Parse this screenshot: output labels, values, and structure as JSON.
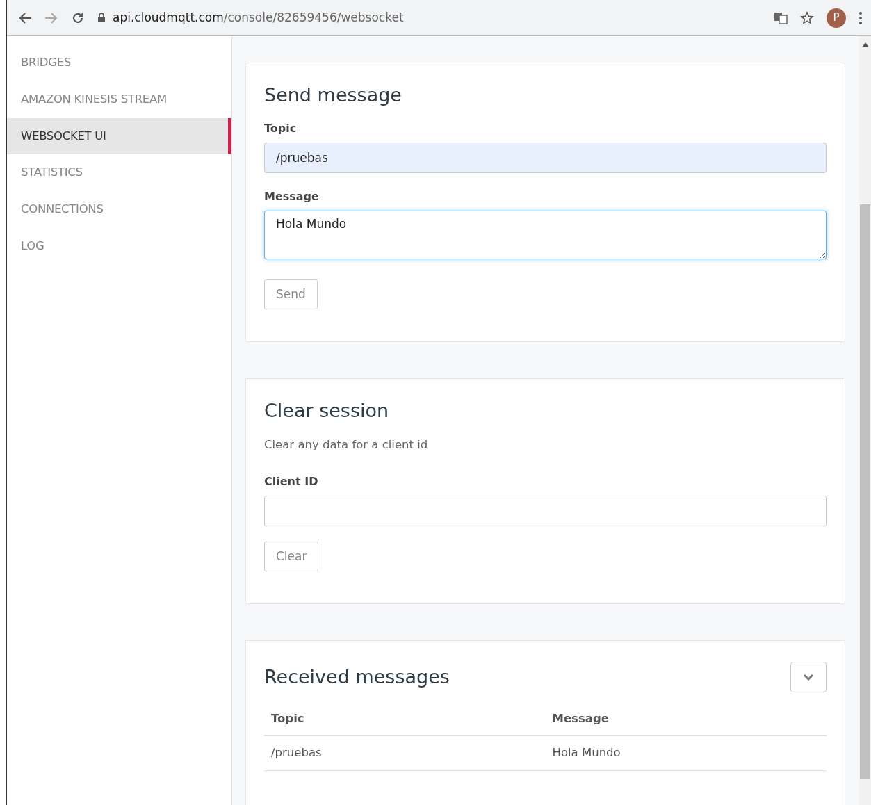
{
  "browser": {
    "url_host": "api.cloudmqtt.com",
    "url_path": "/console/82659456/websocket",
    "avatar": "P"
  },
  "sidebar": {
    "items": [
      {
        "label": "BRIDGES",
        "selected": false
      },
      {
        "label": "AMAZON KINESIS STREAM",
        "selected": false
      },
      {
        "label": "WEBSOCKET UI",
        "selected": true
      },
      {
        "label": "STATISTICS",
        "selected": false
      },
      {
        "label": "CONNECTIONS",
        "selected": false
      },
      {
        "label": "LOG",
        "selected": false
      }
    ]
  },
  "send_message": {
    "title": "Send message",
    "topic_label": "Topic",
    "topic_value": "/pruebas",
    "message_label": "Message",
    "message_value": "Hola Mundo",
    "button": "Send"
  },
  "clear_session": {
    "title": "Clear session",
    "description": "Clear any data for a client id",
    "client_label": "Client ID",
    "button": "Clear"
  },
  "received_messages": {
    "title": "Received messages",
    "table": {
      "columns": [
        "Topic",
        "Message"
      ],
      "rows": [
        [
          "/pruebas",
          "Hola Mundo"
        ]
      ]
    }
  }
}
